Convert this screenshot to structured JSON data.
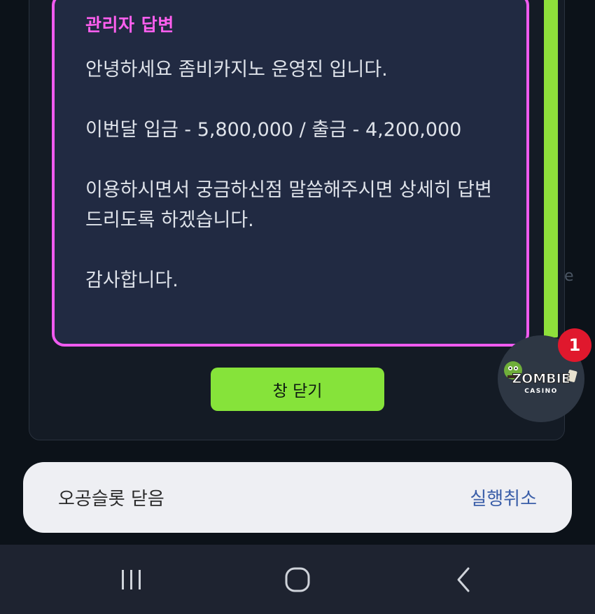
{
  "answer": {
    "title": "관리자 답변",
    "body": "안녕하세요 좀비카지노 운영진 입니다.\n\n이번달 입금 - 5,800,000 / 출금 - 4,200,000\n\n이용하시면서 궁금하신점 말씀해주시면 상세히 답변 드리도록 하겠습니다.\n\n감사합니다."
  },
  "close_button": {
    "label": "창 닫기"
  },
  "side_text": "e",
  "fab": {
    "badge_count": "1",
    "logo_text": "ZOMBIE",
    "logo_sub": "CASINO"
  },
  "toast": {
    "message": "오공슬롯 닫음",
    "action": "실행취소"
  },
  "navbar": {
    "icons": [
      "recent-apps-icon",
      "home-icon",
      "back-icon"
    ]
  },
  "colors": {
    "accent_pink": "#f05bf0",
    "accent_green": "#86e33a",
    "badge_red": "#e0182d",
    "toast_action": "#3a5ea8"
  }
}
